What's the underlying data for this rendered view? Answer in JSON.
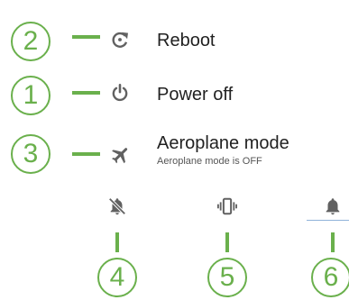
{
  "menu": {
    "reboot": {
      "label": "Reboot",
      "callout": "2",
      "icon": "reboot-icon"
    },
    "power_off": {
      "label": "Power off",
      "callout": "1",
      "icon": "power-icon"
    },
    "aeroplane": {
      "label": "Aeroplane mode",
      "status": "Aeroplane mode is OFF",
      "callout": "3",
      "icon": "airplane-icon"
    }
  },
  "sound_modes": [
    {
      "name": "silent",
      "callout": "4",
      "icon": "bell-off-icon"
    },
    {
      "name": "vibrate",
      "callout": "5",
      "icon": "vibrate-icon"
    },
    {
      "name": "sound",
      "callout": "6",
      "icon": "bell-icon",
      "selected": true
    }
  ],
  "colors": {
    "callout": "#6ab04c",
    "text": "#212121",
    "icon": "#616161",
    "selected_underline": "#8fb3d9"
  }
}
